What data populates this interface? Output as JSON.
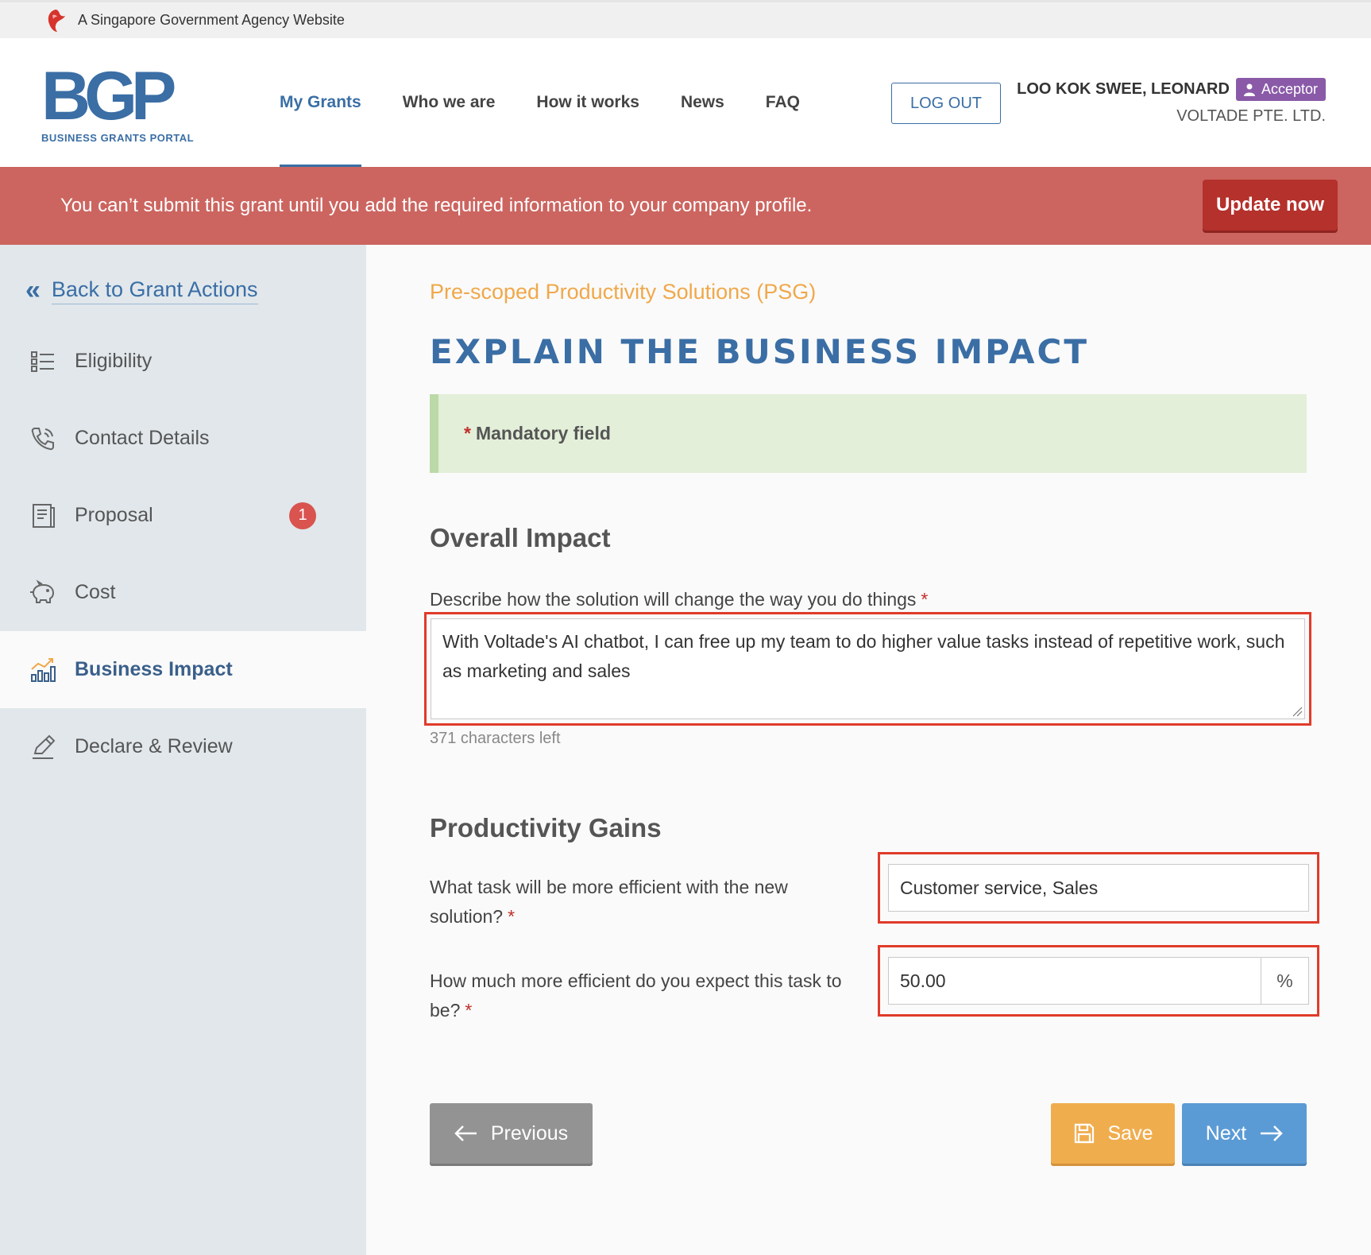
{
  "masthead": {
    "text": "A Singapore Government Agency Website"
  },
  "header": {
    "logo_text": "BGP",
    "logo_sub": "BUSINESS GRANTS PORTAL",
    "nav": [
      {
        "label": "My Grants",
        "active": true
      },
      {
        "label": "Who we are"
      },
      {
        "label": "How it works"
      },
      {
        "label": "News"
      },
      {
        "label": "FAQ"
      }
    ],
    "logout_label": "LOG OUT",
    "user": {
      "name": "LOO KOK SWEE, LEONARD",
      "role": "Acceptor",
      "company": "VOLTADE PTE. LTD."
    }
  },
  "alert": {
    "message": "You can’t submit this grant until you add the required information to your company profile.",
    "action_label": "Update now"
  },
  "sidebar": {
    "back_label": "Back to Grant Actions",
    "items": [
      {
        "label": "Eligibility",
        "icon": "list-icon"
      },
      {
        "label": "Contact Details",
        "icon": "phone-icon"
      },
      {
        "label": "Proposal",
        "icon": "document-icon",
        "badge": "1"
      },
      {
        "label": "Cost",
        "icon": "piggy-bank-icon"
      },
      {
        "label": "Business Impact",
        "icon": "bar-chart-icon",
        "active": true
      },
      {
        "label": "Declare & Review",
        "icon": "pen-icon"
      }
    ]
  },
  "main": {
    "eyebrow": "Pre-scoped Productivity Solutions (PSG)",
    "title": "EXPLAIN THE BUSINESS IMPACT",
    "mandatory_note": "Mandatory field",
    "required_mark": "*",
    "overall": {
      "heading": "Overall Impact",
      "question": "Describe how the solution will change the way you do things",
      "answer": "With Voltade's AI chatbot, I can free up my team to do higher value tasks instead of repetitive work, such as marketing and sales",
      "counter": "371 characters left"
    },
    "productivity": {
      "heading": "Productivity Gains",
      "task_question": "What task will be more efficient with the new solution?",
      "task_answer": "Customer service, Sales",
      "efficiency_question": "How much more efficient do you expect this task to be?",
      "efficiency_answer": "50.00",
      "efficiency_unit": "%"
    },
    "buttons": {
      "previous": "Previous",
      "save": "Save",
      "next": "Next"
    }
  },
  "colors": {
    "brand_blue": "#3a6ea5",
    "alert_red": "#cc6560",
    "update_button": "#b5312c",
    "highlight_box": "#e03b2a",
    "eyebrow_orange": "#f0a84a",
    "role_badge": "#8a5aa8",
    "save_button": "#f0ad4e",
    "next_button": "#5b9bd5",
    "previous_button": "#939393"
  }
}
